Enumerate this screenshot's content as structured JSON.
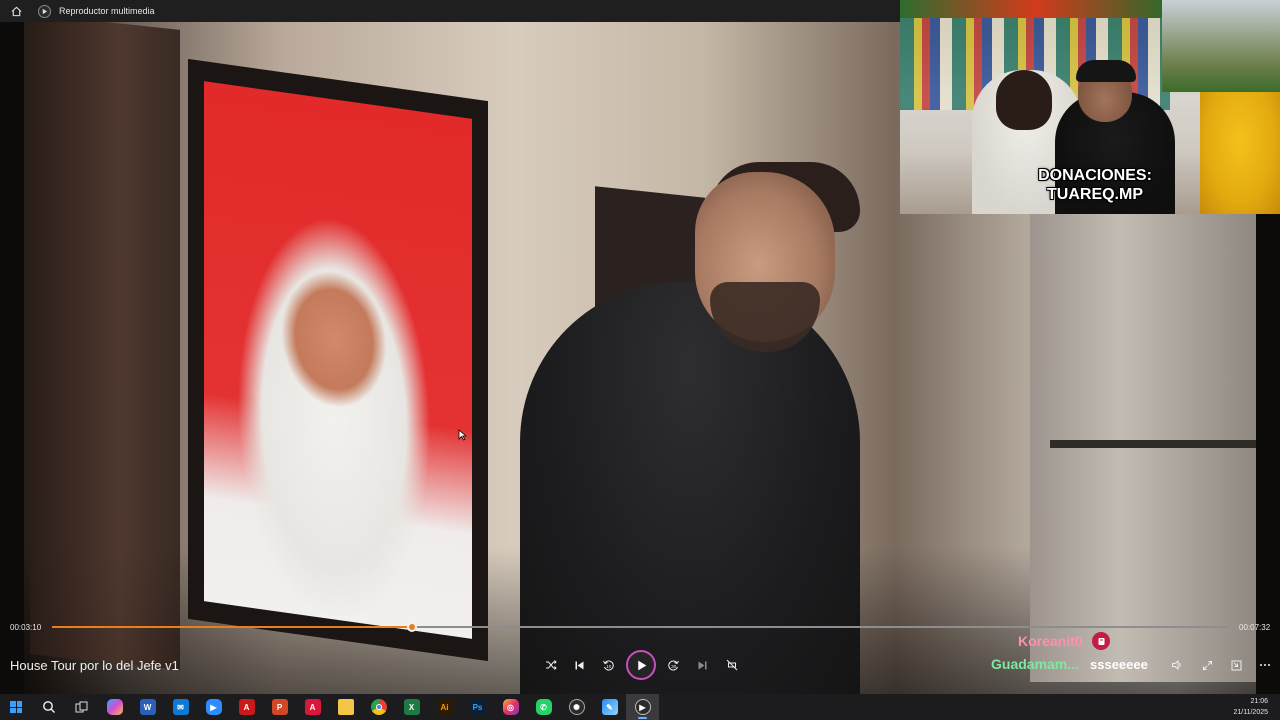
{
  "window": {
    "title": "Reproductor multimedia"
  },
  "overlay": {
    "donation_line1": "DONACIONES:",
    "donation_line2": "TUAREQ.MP"
  },
  "player": {
    "current_time": "00:03:10",
    "total_time": "00:07:32",
    "progress": 0.3057,
    "media_title": "House Tour por lo del Jefe v1",
    "accent_color": "#e67e22",
    "controls": [
      "shuffle-icon",
      "previous-icon",
      "rewind-10-icon",
      "play-icon",
      "forward-30-icon",
      "next-icon",
      "repeat-off-icon"
    ],
    "right_controls": [
      "volume-icon",
      "fullscreen-icon",
      "mini-player-icon",
      "more-icon"
    ]
  },
  "chat": [
    {
      "user": "Koreanit0",
      "color": "#ff8fb0"
    },
    {
      "user": "Guadamam...",
      "message": "ssseeeee",
      "color": "#7de8a4"
    }
  ],
  "taskbar": {
    "apps": [
      "search",
      "task-view",
      "copilot",
      "word",
      "outlook",
      "zoom",
      "acrobat",
      "powerpoint",
      "adobe",
      "file-explorer",
      "chrome",
      "excel",
      "illustrator",
      "photoshop",
      "instagram",
      "whatsapp",
      "chatgpt",
      "paint",
      "media-player"
    ],
    "time": "21:06",
    "date": "21/11/2025"
  }
}
